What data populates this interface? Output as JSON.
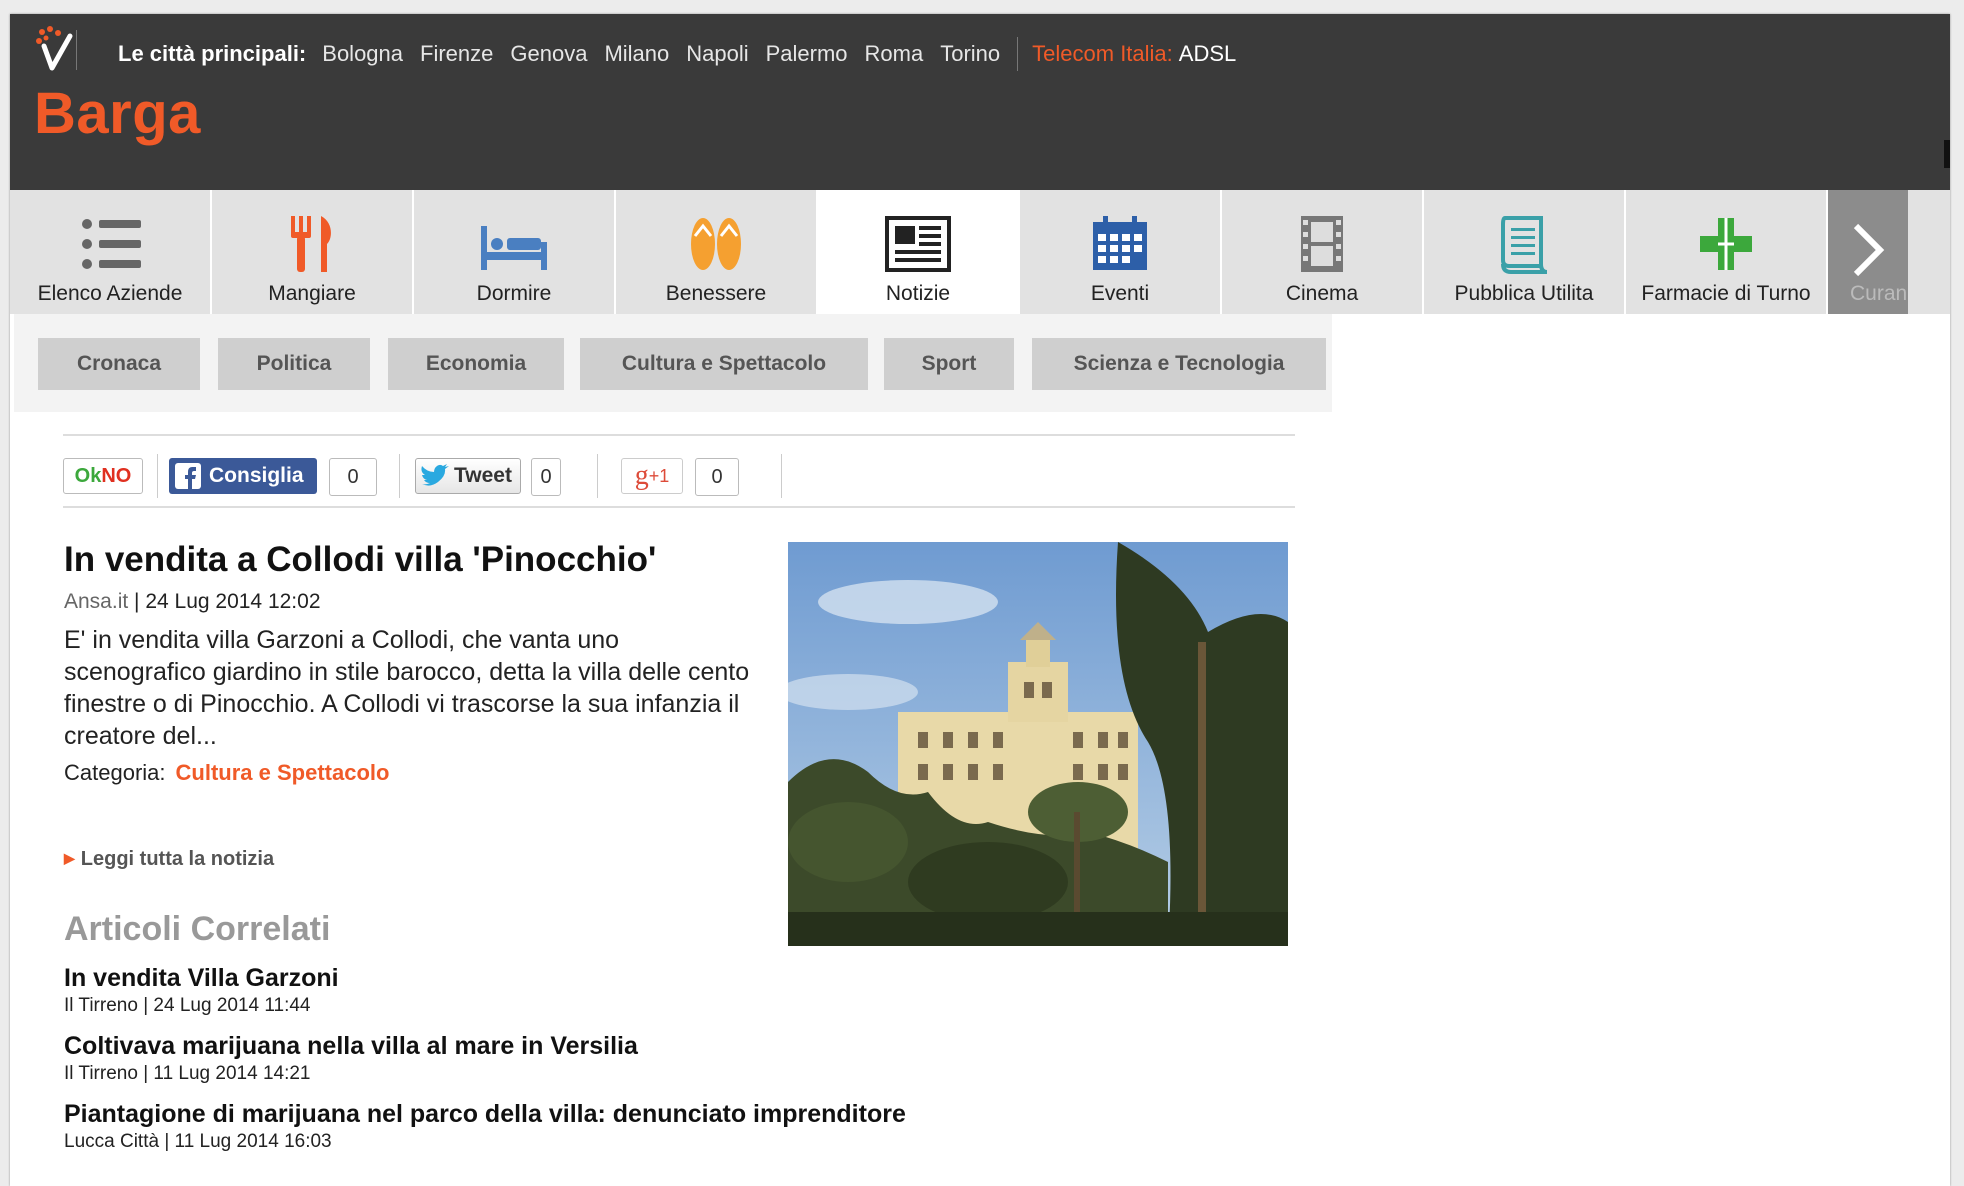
{
  "header": {
    "cities_label": "Le città principali:",
    "cities": [
      "Bologna",
      "Firenze",
      "Genova",
      "Milano",
      "Napoli",
      "Palermo",
      "Roma",
      "Torino"
    ],
    "telecom_label": "Telecom Italia:",
    "telecom_value": "ADSL",
    "town": "Barga"
  },
  "categories": [
    {
      "label": "Elenco Aziende",
      "icon": "list-icon"
    },
    {
      "label": "Mangiare",
      "icon": "fork-knife-icon"
    },
    {
      "label": "Dormire",
      "icon": "bed-icon"
    },
    {
      "label": "Benessere",
      "icon": "flip-flops-icon"
    },
    {
      "label": "Notizie",
      "icon": "newspaper-icon",
      "active": true
    },
    {
      "label": "Eventi",
      "icon": "calendar-icon"
    },
    {
      "label": "Cinema",
      "icon": "film-icon"
    },
    {
      "label": "Pubblica Utilita",
      "icon": "scroll-icon"
    },
    {
      "label": "Farmacie di Turno",
      "icon": "pharmacy-cross-icon"
    }
  ],
  "categories_more_label": "Curan",
  "subnav": [
    "Cronaca",
    "Politica",
    "Economia",
    "Cultura e Spettacolo",
    "Sport",
    "Scienza e Tecnologia"
  ],
  "social": {
    "okno_ok": "Ok",
    "okno_no": "NO",
    "facebook_label": "Consiglia",
    "facebook_count": "0",
    "tweet_label": "Tweet",
    "tweet_count": "0",
    "gplus_label": "+1",
    "gplus_count": "0"
  },
  "article": {
    "title": "In vendita a Collodi villa 'Pinocchio'",
    "source": "Ansa.it",
    "date": "24 Lug 2014 12:02",
    "body": "E' in vendita villa Garzoni a Collodi, che vanta uno scenografico giardino in stile barocco, detta la villa delle cento finestre o di Pinocchio. A Collodi vi trascorse la sua infanzia il creatore del...",
    "category_label": "Categoria:",
    "category_value": "Cultura e Spettacolo",
    "read_more": "Leggi tutta la notizia"
  },
  "related": {
    "heading": "Articoli Correlati",
    "items": [
      {
        "title": "In vendita Villa Garzoni",
        "source": "Il Tirreno",
        "date": "24 Lug 2014 11:44"
      },
      {
        "title": "Coltivava marijuana nella villa al mare in Versilia",
        "source": "Il Tirreno",
        "date": "11 Lug 2014 14:21"
      },
      {
        "title": "Piantagione di marijuana nel parco della villa: denunciato imprenditore",
        "source": "Lucca Città",
        "date": "11 Lug 2014 16:03"
      }
    ]
  },
  "colors": {
    "accent": "#f05a28",
    "header_bg": "#3a3a3a",
    "nav_bg": "#e2e2e2"
  }
}
